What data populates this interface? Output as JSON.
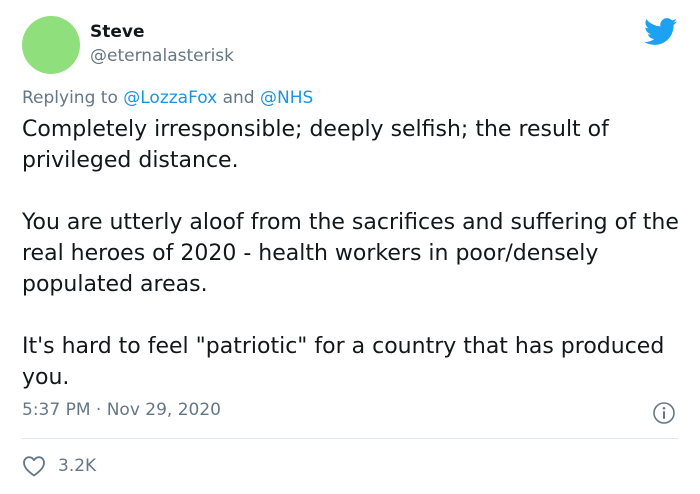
{
  "author": {
    "display_name": "Steve",
    "handle": "@eternalasterisk"
  },
  "reply": {
    "prefix": "Replying to ",
    "mention_1": "@LozzaFox",
    "joiner": " and ",
    "mention_2": "@NHS"
  },
  "tweet": {
    "paragraphs": [
      "Completely irresponsible; deeply selfish; the result of privileged distance.",
      "You are utterly aloof from the sacrifices and suffering of the real heroes of 2020 - health workers in poor/densely populated areas.",
      "It's hard to feel \"patriotic\" for a country that has produced you."
    ],
    "timestamp": "5:37 PM · Nov 29, 2020"
  },
  "stats": {
    "likes": "3.2K"
  },
  "icons": {
    "brand": "twitter-bird-icon",
    "info": "info-icon",
    "like": "heart-icon"
  },
  "colors": {
    "brand_blue": "#1da1f2",
    "mention_blue": "#1b95e0",
    "avatar_green": "#8fe07c",
    "secondary_text": "#657786"
  }
}
